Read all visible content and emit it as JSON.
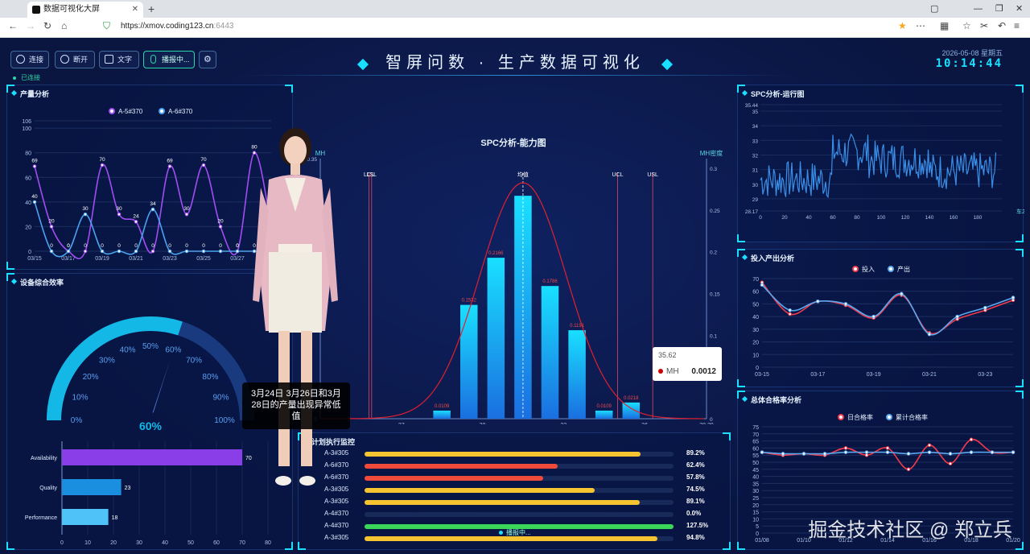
{
  "browser": {
    "tab_title": "数据可视化大屏",
    "url_host": "https://xmov.coding123.cn",
    "url_port": ":6443",
    "new_tab": "+",
    "tab_close": "✕"
  },
  "toolbar": {
    "connect": "连接",
    "disconnect": "断开",
    "text": "文字",
    "broadcast": "播报中...",
    "settings": "⚙",
    "status": "已连接"
  },
  "header": {
    "title": "智屏问数 · 生产数据可视化",
    "date": "2026-05-08 星期五",
    "time": "10:14:44"
  },
  "panels": {
    "output": "产量分析",
    "oee": "设备综合效率",
    "spc_cap": "SPC分析-能力图",
    "spc_run": "SPC分析-运行图",
    "io": "投入产出分析",
    "plan": "计划执行监控",
    "yield": "总体合格率分析"
  },
  "avatar": {
    "subtitle": "3月24日 3月26日和3月28日的产量出现异常低值",
    "recording": "播报中..."
  },
  "tooltip": {
    "x": "35.62",
    "series": "MH",
    "value": "0.0012"
  },
  "watermark": "掘金技术社区 @ 郑立兵",
  "chart_data": [
    {
      "type": "line",
      "id": "output",
      "x": [
        "03/15",
        "03/16",
        "03/17",
        "03/18",
        "03/19",
        "03/20",
        "03/21",
        "03/22",
        "03/23",
        "03/24",
        "03/25",
        "03/26",
        "03/27",
        "03/28",
        "03/29"
      ],
      "xticks": [
        "03/15",
        "03/17",
        "03/19",
        "03/21",
        "03/23",
        "03/25",
        "03/27",
        "03/29"
      ],
      "ylim": [
        0,
        106
      ],
      "yticks": [
        0,
        20,
        40,
        60,
        80,
        100,
        106
      ],
      "series": [
        {
          "name": "A-5#370",
          "color": "#a24df2",
          "values": [
            69,
            20,
            0,
            0,
            70,
            30,
            24,
            0,
            69,
            30,
            70,
            20,
            0,
            80,
            20
          ]
        },
        {
          "name": "A-6#370",
          "color": "#4aa3f0",
          "values": [
            40,
            0,
            0,
            30,
            0,
            0,
            0,
            34,
            0,
            0,
            0,
            0,
            0,
            0,
            0
          ]
        }
      ]
    },
    {
      "type": "gauge",
      "id": "oee",
      "value": 60,
      "label": "60%",
      "ticks": [
        "0%",
        "10%",
        "20%",
        "30%",
        "40%",
        "50%",
        "60%",
        "70%",
        "80%",
        "90%",
        "100%"
      ]
    },
    {
      "type": "bar",
      "id": "oee_bars",
      "categories": [
        "Availability",
        "Quality",
        "Performance"
      ],
      "values": [
        70,
        23,
        18
      ],
      "colors": [
        "#8a3ee8",
        "#1a8fe0",
        "#4fc3f7"
      ],
      "xlim": [
        0,
        80
      ],
      "xticks": [
        0,
        10,
        20,
        30,
        40,
        50,
        60,
        70,
        80
      ]
    },
    {
      "type": "bar",
      "id": "spc_cap",
      "title": "SPC分析-能力图",
      "ylabel": "MH",
      "y2label": "MH密度",
      "bins": [
        {
          "x": 28.5,
          "v": 0.0109
        },
        {
          "x": 29.5,
          "v": 0.1532
        },
        {
          "x": 30.5,
          "v": 0.2166
        },
        {
          "x": 31.5,
          "v": 0.3
        },
        {
          "x": 32.5,
          "v": 0.1786
        },
        {
          "x": 33.5,
          "v": 0.1191
        },
        {
          "x": 34.5,
          "v": 0.0109
        },
        {
          "x": 35.5,
          "v": 0.0218
        }
      ],
      "labels": [
        "0.0109",
        "0.1532",
        "0.2166",
        "",
        "0.1786",
        "0.1191",
        "0.0109",
        "0.0218"
      ],
      "xlim": [
        24,
        38.29
      ],
      "xticks": [
        "27",
        "30",
        "33",
        "36",
        "38.29"
      ],
      "ylim": [
        0,
        0.35
      ],
      "yticks": [
        "0",
        "0.3",
        "0.35"
      ],
      "y2ticks": [
        "0",
        "0.05",
        "0.1",
        "0.15",
        "0.2",
        "0.25",
        "0.3"
      ],
      "vlines": [
        {
          "x": 25.8,
          "label": "LCL"
        },
        {
          "x": 25.9,
          "label": "LSL"
        },
        {
          "x": 31.5,
          "label": "均值"
        },
        {
          "x": 35.0,
          "label": "UCL"
        },
        {
          "x": 36.3,
          "label": "USL"
        }
      ],
      "curve": {
        "mean": 31.5,
        "sd": 1.6
      }
    },
    {
      "type": "line",
      "id": "spc_run",
      "xlim": [
        0,
        200
      ],
      "xticks": [
        "0",
        "20",
        "40",
        "60",
        "80",
        "100",
        "120",
        "140",
        "160",
        "180"
      ],
      "ylim": [
        28.17,
        35.44
      ],
      "yticks": [
        "28.17",
        "29",
        "30",
        "31",
        "32",
        "33",
        "34",
        "35",
        "35.44"
      ],
      "xlabel_right": "车2"
    },
    {
      "type": "line",
      "id": "io",
      "x": [
        "03-15",
        "03-16",
        "03-17",
        "03-18",
        "03-19",
        "03-20",
        "03-21",
        "03-22",
        "03-23",
        "03-24"
      ],
      "xticks": [
        "03-15",
        "03-17",
        "03-19",
        "03-21",
        "03-23"
      ],
      "ylim": [
        0,
        70
      ],
      "yticks": [
        0,
        10,
        20,
        30,
        40,
        50,
        60,
        70
      ],
      "series": [
        {
          "name": "投入",
          "color": "#f23a4a",
          "values": [
            67,
            42,
            52,
            49,
            39,
            57,
            27,
            38,
            45,
            53
          ]
        },
        {
          "name": "产出",
          "color": "#5aa8f0",
          "values": [
            65,
            45,
            52,
            50,
            40,
            58,
            26,
            40,
            47,
            55
          ]
        }
      ]
    },
    {
      "type": "line",
      "id": "yield",
      "x": [
        "01/08",
        "01/09",
        "01/10",
        "01/11",
        "01/12",
        "01/13",
        "01/14",
        "01/15",
        "01/16",
        "01/17",
        "01/18",
        "01/19",
        "01/20"
      ],
      "xticks": [
        "01/08",
        "01/10",
        "01/12",
        "01/14",
        "01/16",
        "01/18",
        "01/20"
      ],
      "ylim": [
        0,
        75
      ],
      "yticks": [
        0,
        5,
        10,
        15,
        20,
        25,
        30,
        35,
        40,
        45,
        50,
        55,
        60,
        65,
        70,
        75
      ],
      "series": [
        {
          "name": "日合格率",
          "color": "#f23a4a",
          "values": [
            57,
            55,
            56,
            55,
            60,
            55,
            60,
            45,
            62,
            49,
            66,
            57,
            57
          ]
        },
        {
          "name": "累计合格率",
          "color": "#5aa8f0",
          "values": [
            57,
            56,
            56,
            56,
            57,
            57,
            57,
            56,
            57,
            56,
            57,
            57,
            57
          ]
        }
      ]
    },
    {
      "type": "table",
      "id": "plan",
      "rows": [
        {
          "name": "A-3#305",
          "pct": "89.2%",
          "v": 89.2,
          "c": "#f5c430"
        },
        {
          "name": "A-6#370",
          "pct": "62.4%",
          "v": 62.4,
          "c": "#f04a3a"
        },
        {
          "name": "A-6#370",
          "pct": "57.8%",
          "v": 57.8,
          "c": "#f04a3a"
        },
        {
          "name": "A-3#305",
          "pct": "74.5%",
          "v": 74.5,
          "c": "#f5c430"
        },
        {
          "name": "A-3#305",
          "pct": "89.1%",
          "v": 89.1,
          "c": "#f5c430"
        },
        {
          "name": "A-4#370",
          "pct": "0.0%",
          "v": 0,
          "c": "#f5c430"
        },
        {
          "name": "A-4#370",
          "pct": "127.5%",
          "v": 100,
          "c": "#3ad65a"
        },
        {
          "name": "A-3#305",
          "pct": "94.8%",
          "v": 94.8,
          "c": "#f5c430"
        }
      ]
    }
  ]
}
